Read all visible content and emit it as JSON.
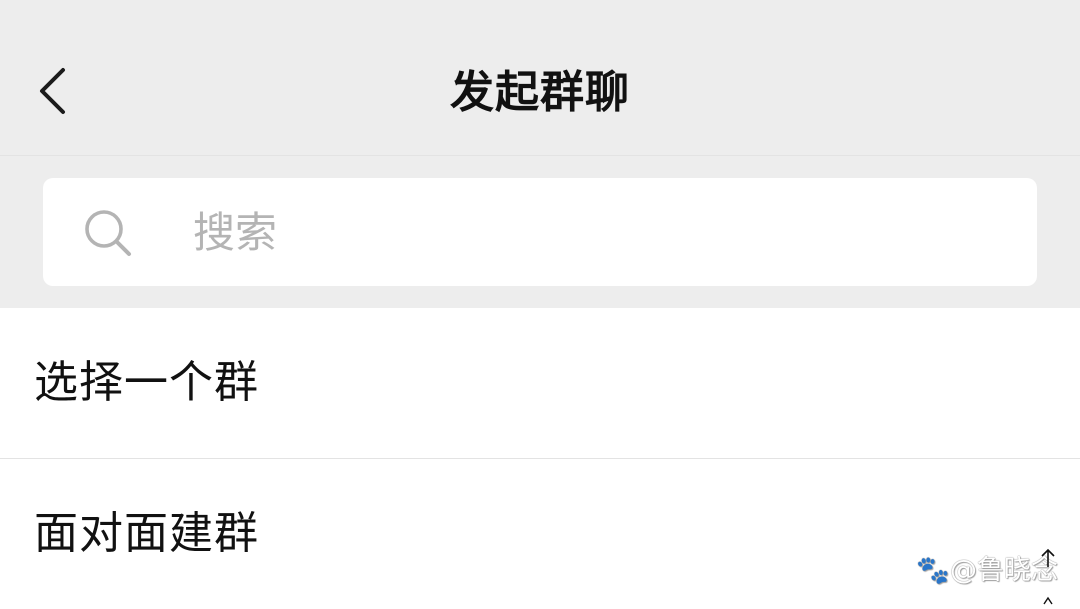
{
  "header": {
    "title": "发起群聊",
    "back_icon": "chevron-left-icon"
  },
  "search": {
    "placeholder": "搜索",
    "value": "",
    "icon": "search-icon"
  },
  "list": {
    "items": [
      {
        "label": "选择一个群"
      },
      {
        "label": "面对面建群"
      }
    ]
  },
  "watermark": {
    "text": "@鲁晓念"
  },
  "colors": {
    "header_bg": "#ededed",
    "list_bg": "#ffffff",
    "text": "#111111",
    "placeholder": "#b4b4b4",
    "divider": "#e3e3e3"
  }
}
